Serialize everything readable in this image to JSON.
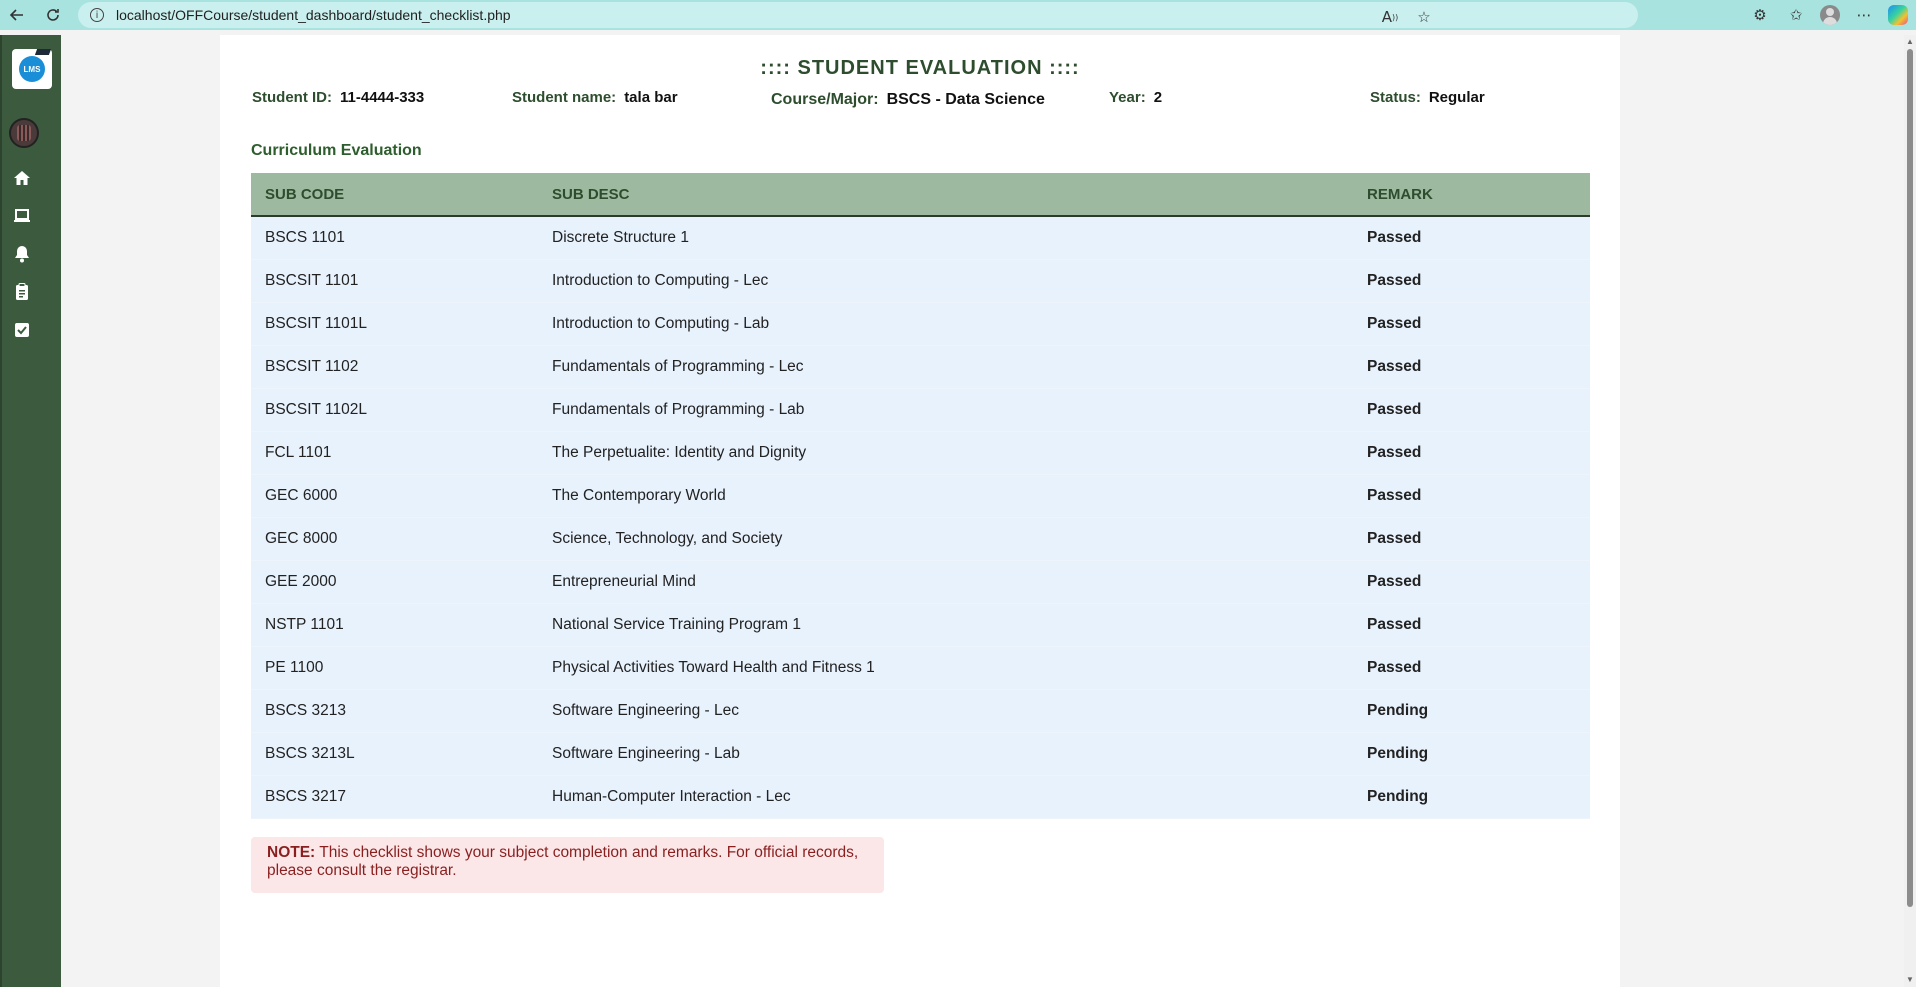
{
  "browser": {
    "url": "localhost/OFFCourse/student_dashboard/student_checklist.php",
    "icons": [
      "back-icon",
      "reload-icon",
      "site-info-icon",
      "read-aloud-icon",
      "favorite-icon",
      "extensions-icon",
      "favorites-icon",
      "profile-icon",
      "more-icon",
      "copilot-icon"
    ]
  },
  "sidebar": {
    "logo_text": "LMS",
    "icons": [
      "avatar",
      "home-icon",
      "laptop-icon",
      "bell-icon",
      "clipboard-icon",
      "checkbox-icon"
    ],
    "bg_color": "#3c5b3e"
  },
  "page": {
    "title": ":::: STUDENT EVALUATION ::::",
    "student_id_label": "Student ID:",
    "student_id": "11-4444-333",
    "student_name_label": "Student name:",
    "student_name": "tala bar",
    "course_label": "Course/Major:",
    "course": "BSCS - Data Science",
    "year_label": "Year:",
    "year": "2",
    "status_label": "Status:",
    "status": "Regular",
    "section_title": "Curriculum Evaluation"
  },
  "table": {
    "headers": [
      "SUB CODE",
      "SUB DESC",
      "REMARK"
    ],
    "rows": [
      {
        "code": "BSCS 1101",
        "desc": "Discrete Structure 1",
        "remark": "Passed"
      },
      {
        "code": "BSCSIT 1101",
        "desc": "Introduction to Computing - Lec",
        "remark": "Passed"
      },
      {
        "code": "BSCSIT 1101L",
        "desc": "Introduction to Computing - Lab",
        "remark": "Passed"
      },
      {
        "code": "BSCSIT 1102",
        "desc": "Fundamentals of Programming - Lec",
        "remark": "Passed"
      },
      {
        "code": "BSCSIT 1102L",
        "desc": "Fundamentals of Programming - Lab",
        "remark": "Passed"
      },
      {
        "code": "FCL 1101",
        "desc": "The Perpetualite: Identity and Dignity",
        "remark": "Passed"
      },
      {
        "code": "GEC 6000",
        "desc": "The Contemporary World",
        "remark": "Passed"
      },
      {
        "code": "GEC 8000",
        "desc": "Science, Technology, and Society",
        "remark": "Passed"
      },
      {
        "code": "GEE 2000",
        "desc": "Entrepreneurial Mind",
        "remark": "Passed"
      },
      {
        "code": "NSTP 1101",
        "desc": "National Service Training Program 1",
        "remark": "Passed"
      },
      {
        "code": "PE 1100",
        "desc": "Physical Activities Toward Health and Fitness 1",
        "remark": "Passed"
      },
      {
        "code": "BSCS 3213",
        "desc": "Software Engineering - Lec",
        "remark": "Pending"
      },
      {
        "code": "BSCS 3213L",
        "desc": "Software Engineering - Lab",
        "remark": "Pending"
      },
      {
        "code": "BSCS 3217",
        "desc": "Human-Computer Interaction - Lec",
        "remark": "Pending"
      }
    ]
  },
  "note": {
    "label": "NOTE:",
    "text": " This checklist shows your subject completion and remarks. For official records, please consult the registrar."
  },
  "colors": {
    "passed": "#1f7a1f",
    "pending": "#9e1515",
    "header_bg": "#9db99f",
    "row_bg": "#e8f2fd",
    "browser_bar": "#a8e3e0"
  }
}
